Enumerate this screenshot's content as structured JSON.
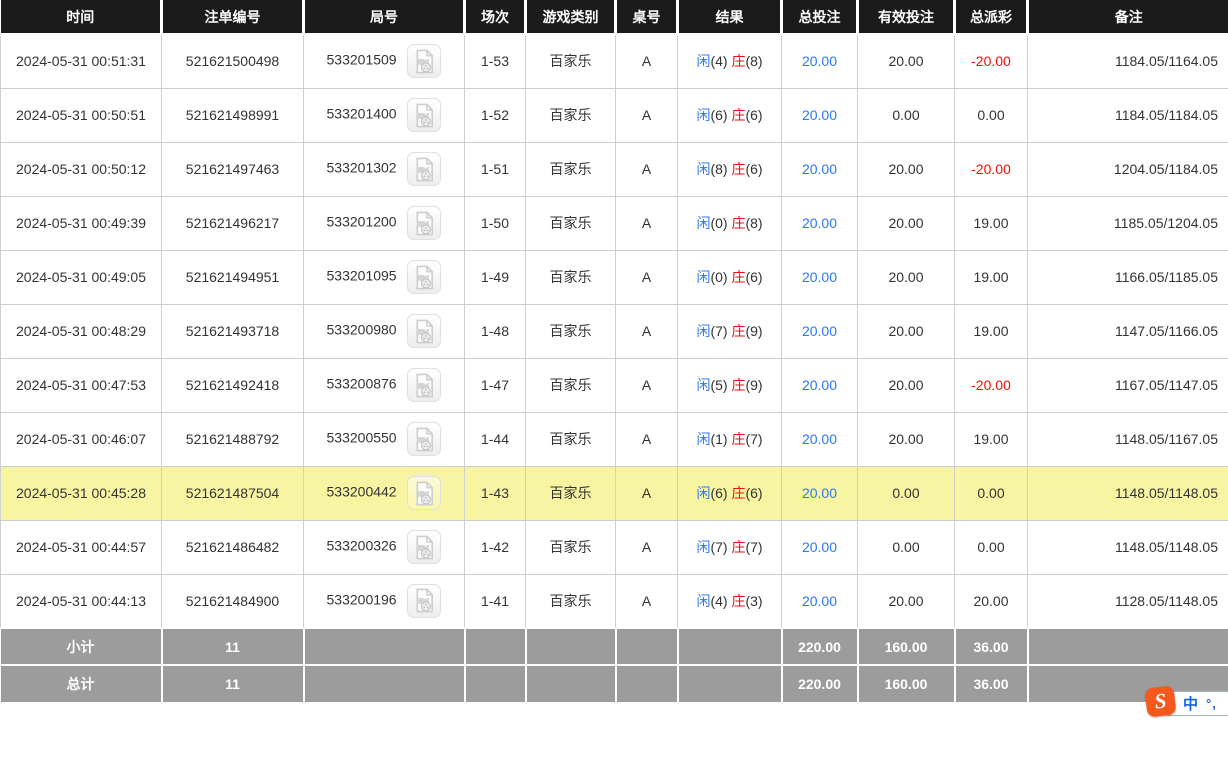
{
  "table": {
    "columns": [
      {
        "key": "time",
        "label": "时间"
      },
      {
        "key": "bet_id",
        "label": "注单编号"
      },
      {
        "key": "round",
        "label": "局号"
      },
      {
        "key": "session",
        "label": "场次"
      },
      {
        "key": "game_type",
        "label": "游戏类别"
      },
      {
        "key": "table_no",
        "label": "桌号"
      },
      {
        "key": "result",
        "label": "结果"
      },
      {
        "key": "total_bet",
        "label": "总投注"
      },
      {
        "key": "valid_bet",
        "label": "有效投注"
      },
      {
        "key": "payout",
        "label": "总派彩"
      },
      {
        "key": "remark",
        "label": "备注"
      }
    ],
    "result_labels": {
      "player": "闲",
      "banker": "庄"
    },
    "rows": [
      {
        "time": "2024-05-31 00:51:31",
        "bet_id": "521621500498",
        "round": "533201509",
        "session": "1-53",
        "game_type": "百家乐",
        "table_no": "A",
        "player": "4",
        "banker": "8",
        "total_bet": "20.00",
        "valid_bet": "20.00",
        "payout": "-20.00",
        "remark": "1184.05/1164.05",
        "highlighted": false
      },
      {
        "time": "2024-05-31 00:50:51",
        "bet_id": "521621498991",
        "round": "533201400",
        "session": "1-52",
        "game_type": "百家乐",
        "table_no": "A",
        "player": "6",
        "banker": "6",
        "total_bet": "20.00",
        "valid_bet": "0.00",
        "payout": "0.00",
        "remark": "1184.05/1184.05",
        "highlighted": false
      },
      {
        "time": "2024-05-31 00:50:12",
        "bet_id": "521621497463",
        "round": "533201302",
        "session": "1-51",
        "game_type": "百家乐",
        "table_no": "A",
        "player": "8",
        "banker": "6",
        "total_bet": "20.00",
        "valid_bet": "20.00",
        "payout": "-20.00",
        "remark": "1204.05/1184.05",
        "highlighted": false
      },
      {
        "time": "2024-05-31 00:49:39",
        "bet_id": "521621496217",
        "round": "533201200",
        "session": "1-50",
        "game_type": "百家乐",
        "table_no": "A",
        "player": "0",
        "banker": "8",
        "total_bet": "20.00",
        "valid_bet": "20.00",
        "payout": "19.00",
        "remark": "1185.05/1204.05",
        "highlighted": false
      },
      {
        "time": "2024-05-31 00:49:05",
        "bet_id": "521621494951",
        "round": "533201095",
        "session": "1-49",
        "game_type": "百家乐",
        "table_no": "A",
        "player": "0",
        "banker": "6",
        "total_bet": "20.00",
        "valid_bet": "20.00",
        "payout": "19.00",
        "remark": "1166.05/1185.05",
        "highlighted": false
      },
      {
        "time": "2024-05-31 00:48:29",
        "bet_id": "521621493718",
        "round": "533200980",
        "session": "1-48",
        "game_type": "百家乐",
        "table_no": "A",
        "player": "7",
        "banker": "9",
        "total_bet": "20.00",
        "valid_bet": "20.00",
        "payout": "19.00",
        "remark": "1147.05/1166.05",
        "highlighted": false
      },
      {
        "time": "2024-05-31 00:47:53",
        "bet_id": "521621492418",
        "round": "533200876",
        "session": "1-47",
        "game_type": "百家乐",
        "table_no": "A",
        "player": "5",
        "banker": "9",
        "total_bet": "20.00",
        "valid_bet": "20.00",
        "payout": "-20.00",
        "remark": "1167.05/1147.05",
        "highlighted": false
      },
      {
        "time": "2024-05-31 00:46:07",
        "bet_id": "521621488792",
        "round": "533200550",
        "session": "1-44",
        "game_type": "百家乐",
        "table_no": "A",
        "player": "1",
        "banker": "7",
        "total_bet": "20.00",
        "valid_bet": "20.00",
        "payout": "19.00",
        "remark": "1148.05/1167.05",
        "highlighted": false
      },
      {
        "time": "2024-05-31 00:45:28",
        "bet_id": "521621487504",
        "round": "533200442",
        "session": "1-43",
        "game_type": "百家乐",
        "table_no": "A",
        "player": "6",
        "banker": "6",
        "total_bet": "20.00",
        "valid_bet": "0.00",
        "payout": "0.00",
        "remark": "1148.05/1148.05",
        "highlighted": true
      },
      {
        "time": "2024-05-31 00:44:57",
        "bet_id": "521621486482",
        "round": "533200326",
        "session": "1-42",
        "game_type": "百家乐",
        "table_no": "A",
        "player": "7",
        "banker": "7",
        "total_bet": "20.00",
        "valid_bet": "0.00",
        "payout": "0.00",
        "remark": "1148.05/1148.05",
        "highlighted": false
      },
      {
        "time": "2024-05-31 00:44:13",
        "bet_id": "521621484900",
        "round": "533200196",
        "session": "1-41",
        "game_type": "百家乐",
        "table_no": "A",
        "player": "4",
        "banker": "3",
        "total_bet": "20.00",
        "valid_bet": "20.00",
        "payout": "20.00",
        "remark": "1128.05/1148.05",
        "highlighted": false
      }
    ],
    "footer": [
      {
        "label": "小计",
        "count": "11",
        "total_bet": "220.00",
        "valid_bet": "160.00",
        "payout": "36.00"
      },
      {
        "label": "总计",
        "count": "11",
        "total_bet": "220.00",
        "valid_bet": "160.00",
        "payout": "36.00"
      }
    ]
  },
  "ime_bar": {
    "logo": "S",
    "mode": "中",
    "punct": "°,"
  },
  "colors": {
    "header_bg": "#1b1b1b",
    "footer_bg": "#9c9c9c",
    "row_highlight": "#f8f5a2",
    "link_blue": "#2d78f5",
    "negative_red": "#f20d0d",
    "border": "#cfcfcf",
    "ime_orange": "#f4581c"
  }
}
